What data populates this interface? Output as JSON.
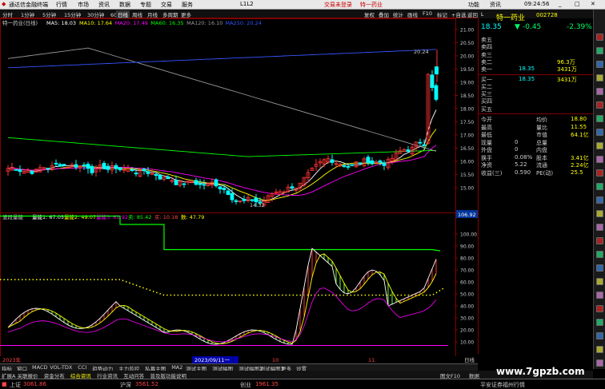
{
  "menubar": {
    "app_title": "通达信金融终端",
    "items": [
      "行情",
      "市场",
      "资讯",
      "数据",
      "专题",
      "交易",
      "服务"
    ],
    "center_notice": "L1L2",
    "alert": "交易未登录",
    "stock_short": "特一药业",
    "right_items": [
      "功能",
      "资讯"
    ],
    "time": "09:24:56"
  },
  "toolbar": {
    "periods": [
      "分时",
      "1分钟",
      "5分钟",
      "15分钟",
      "30分钟",
      "60分钟",
      "日线",
      "周线",
      "月线",
      "多周期",
      "更多"
    ],
    "selected": "日线",
    "right_buttons": [
      "复权",
      "叠加",
      "统计",
      "画线",
      "F10",
      "标记",
      "+自选",
      "返回"
    ]
  },
  "main_chart": {
    "legend_name": "特一药业(日线)",
    "ma_labels": [
      {
        "text": "MA5: 18.03",
        "color": "#ffffff"
      },
      {
        "text": "MA10: 17.64",
        "color": "#ffff00"
      },
      {
        "text": "MA20: 17.49",
        "color": "#ff00ff"
      },
      {
        "text": "MA60: 16.35",
        "color": "#00ff00"
      },
      {
        "text": "MA120: 16.10",
        "color": "#999999"
      },
      {
        "text": "MA250: 20.24",
        "color": "#3355ff"
      }
    ],
    "y_ticks": [
      "21.00",
      "20.50",
      "20.00",
      "19.50",
      "19.00",
      "18.50",
      "18.00",
      "17.50",
      "17.00",
      "16.50",
      "16.00",
      "15.50",
      "15.00"
    ],
    "high_label": "20.24",
    "low_label": "14.32"
  },
  "indicator": {
    "title": "波段量能",
    "values": [
      {
        "text": "量能1: 67.05",
        "color": "#ffffff"
      },
      {
        "text": "量能2: 49.07",
        "color": "#ffff00"
      },
      {
        "text": "量能3: 61.92",
        "color": "#ff00ff"
      },
      {
        "text": "卖: 85.42",
        "color": "#00ff00"
      },
      {
        "text": "买: 10.18",
        "color": "#ff4444"
      },
      {
        "text": "数: 47.79",
        "color": "#ffff00"
      }
    ],
    "y_ticks": [
      "100.00",
      "90.00",
      "80.00",
      "70.00",
      "60.00",
      "50.00",
      "40.00",
      "30.00",
      "20.00",
      "10.00"
    ],
    "current_label": "106.92"
  },
  "x_axis": {
    "labels": [
      "2023年",
      "2023/09/11一",
      "10",
      "11",
      "日线"
    ]
  },
  "quote": {
    "code": "002728",
    "name": "特一药业",
    "price": "18.35",
    "change": "-0.45",
    "change_pct": "-2.39%",
    "asks": [
      {
        "label": "卖五",
        "price": "",
        "vol": ""
      },
      {
        "label": "卖四",
        "price": "",
        "vol": ""
      },
      {
        "label": "卖三",
        "price": "",
        "vol": ""
      },
      {
        "label": "卖二",
        "price": "",
        "vol": "96.3万"
      },
      {
        "label": "卖一",
        "price": "18.35",
        "vol": "3431万"
      }
    ],
    "bids": [
      {
        "label": "买一",
        "price": "18.35",
        "vol": "3431万"
      },
      {
        "label": "买二",
        "price": "",
        "vol": ""
      },
      {
        "label": "买三",
        "price": "",
        "vol": ""
      },
      {
        "label": "买四",
        "price": "",
        "vol": ""
      },
      {
        "label": "买五",
        "price": "",
        "vol": ""
      }
    ],
    "stats": [
      {
        "l1": "今开",
        "v1": "",
        "l2": "均价",
        "v2": "18.80"
      },
      {
        "l1": "最高",
        "v1": "",
        "l2": "量比",
        "v2": "11.55"
      },
      {
        "l1": "最低",
        "v1": "",
        "l2": "市值",
        "v2": "64.1亿"
      },
      {
        "l1": "现量",
        "v1": "0",
        "l2": "总量",
        "v2": ""
      },
      {
        "l1": "外盘",
        "v1": "0",
        "l2": "内盘",
        "v2": ""
      },
      {
        "l1": "换手",
        "v1": "0.08%",
        "l2": "股本",
        "v2": "3.41亿"
      },
      {
        "l1": "净资",
        "v1": "5.22",
        "l2": "流通",
        "v2": "2.24亿"
      },
      {
        "l1": "收益(三)",
        "v1": "0.590",
        "l2": "PE(动)",
        "v2": "25.5"
      }
    ]
  },
  "tabs_bottom": [
    "指标",
    "窗口",
    "MACD",
    "VOL-TDX",
    "CCI",
    "趋势动力",
    "主力监控",
    "私募主图",
    "MA2",
    "测试主图",
    "测试幅图",
    "测试幅图2",
    "测试幅图3",
    "更多",
    "设置"
  ],
  "tabs_bottom2": [
    "扩展A",
    "关联报价",
    "资金分布",
    "综合资讯",
    "行业资讯",
    "互动问答",
    "普及版功能说明"
  ],
  "tabs_bottom2_right": [
    "图文F10",
    "数据"
  ],
  "status": {
    "items": [
      {
        "label": "上证",
        "value": "3061.86",
        "color": "#ff4444"
      },
      {
        "label": "沪深",
        "value": "3561.52",
        "color": "#ff4444"
      },
      {
        "label": "创业",
        "value": "1961.35",
        "color": "#ff4444"
      }
    ],
    "right": "平安证券福州行情"
  },
  "watermark": "www.7gpzb.com",
  "colors": {
    "up": "#ff3333",
    "down": "#00ffff",
    "ma5": "#ffffff",
    "ma10": "#ffff00",
    "ma20": "#ff00ff",
    "ma60": "#00ff00",
    "ma120": "#999999",
    "ma250": "#3355ff"
  }
}
